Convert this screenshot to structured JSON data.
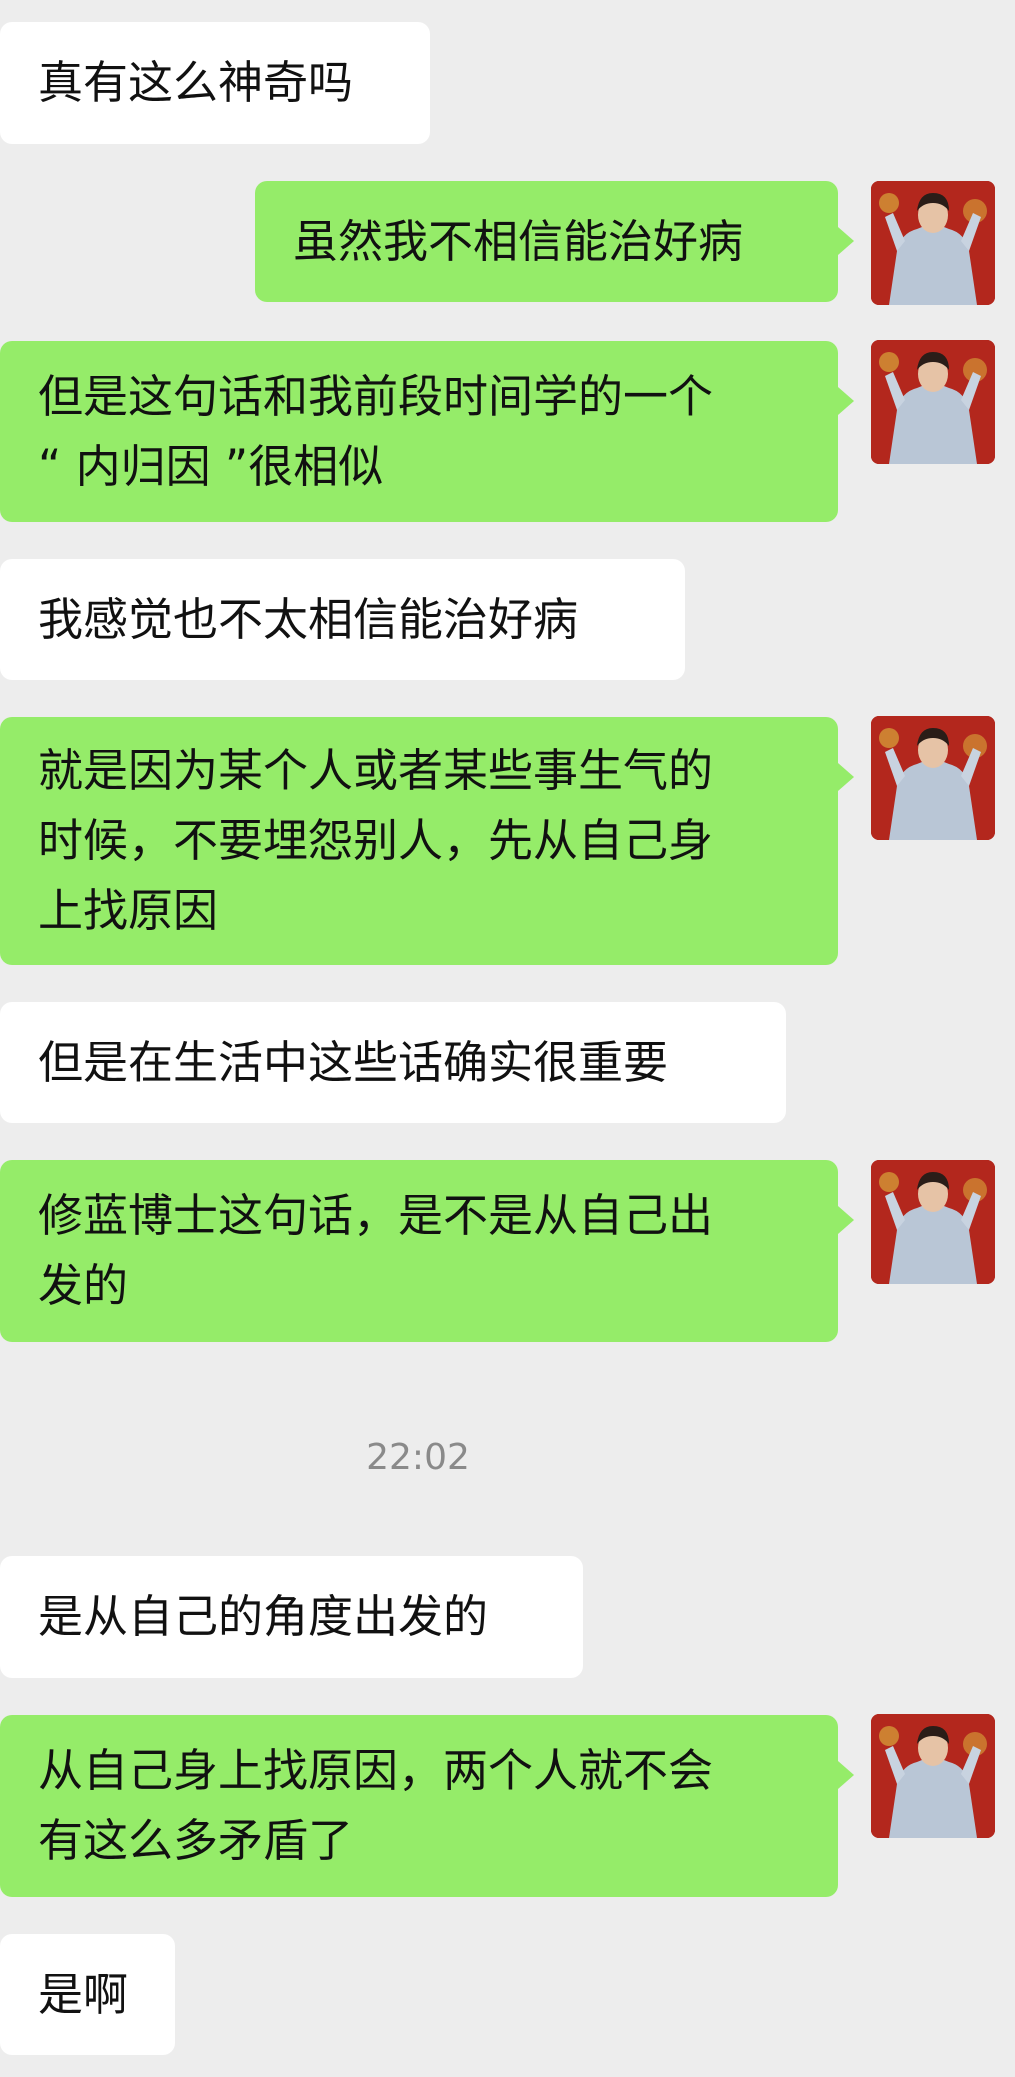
{
  "messages": [
    {
      "side": "in",
      "lines": [
        "真有这么神奇吗"
      ]
    },
    {
      "side": "out",
      "lines": [
        "虽然我不相信能治好病"
      ]
    },
    {
      "side": "out",
      "lines": [
        "但是这句话和我前段时间学的一个",
        "“ 内归因 ”很相似"
      ]
    },
    {
      "side": "in",
      "lines": [
        "我感觉也不太相信能治好病"
      ]
    },
    {
      "side": "out",
      "lines": [
        "就是因为某个人或者某些事生气的",
        "时候，不要埋怨别人，先从自己身",
        "上找原因"
      ]
    },
    {
      "side": "in",
      "lines": [
        "但是在生活中这些话确实很重要"
      ]
    },
    {
      "side": "out",
      "lines": [
        "修蓝博士这句话，是不是从自己出",
        "发的"
      ]
    },
    {
      "side": "in",
      "lines": [
        "是从自己的角度出发的"
      ]
    },
    {
      "side": "out",
      "lines": [
        "从自己身上找原因，两个人就不会",
        "有这么多矛盾了"
      ]
    },
    {
      "side": "in",
      "lines": [
        "是啊"
      ]
    }
  ],
  "timestamp": "22:02",
  "colors": {
    "background": "#ededed",
    "incoming_bubble": "#ffffff",
    "outgoing_bubble": "#95ec69",
    "text": "#111111",
    "timestamp": "#8a8a8a",
    "avatar_background": "#b3271d"
  },
  "avatar": {
    "icon": "user-avatar-icon"
  }
}
